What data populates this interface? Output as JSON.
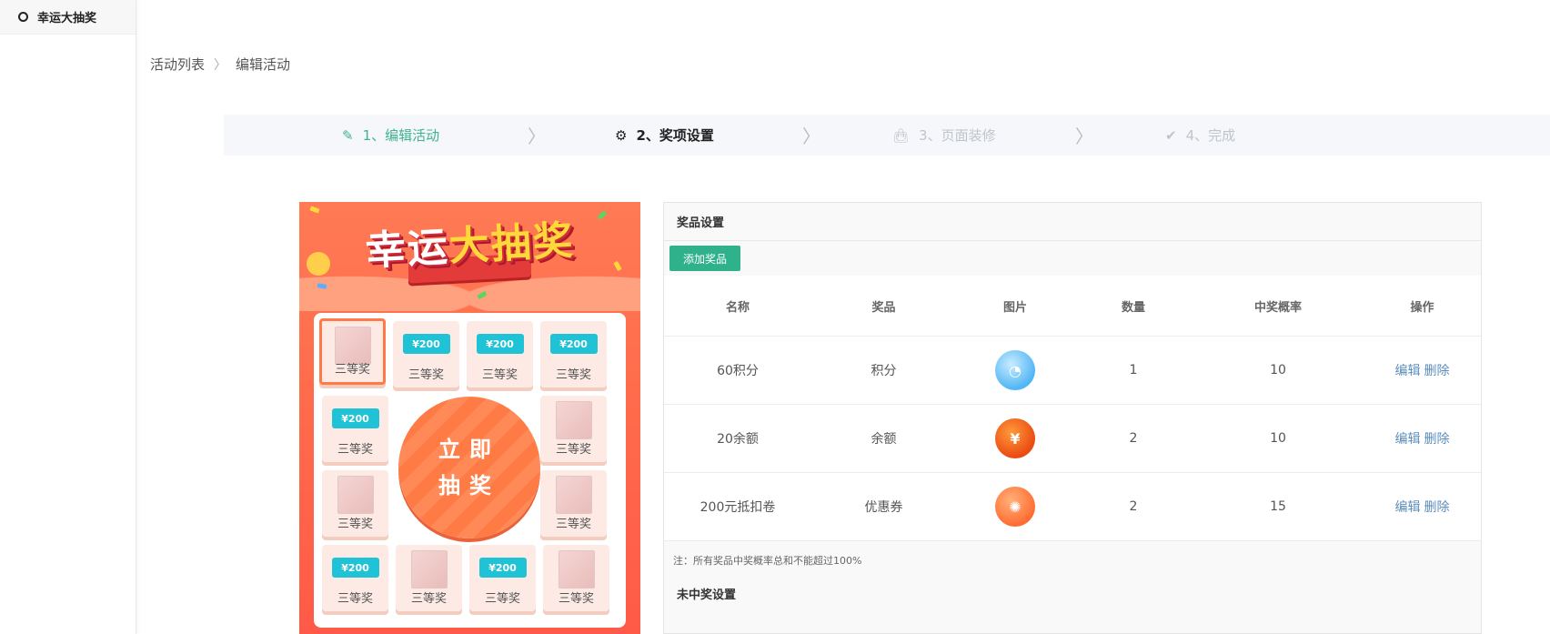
{
  "sidebar": {
    "items": [
      {
        "label": "幸运大抽奖"
      }
    ]
  },
  "breadcrumb": {
    "parent": "活动列表",
    "current": "编辑活动"
  },
  "steps": [
    {
      "label": "1、编辑活动",
      "state": "done",
      "icon": "edit-pen-icon"
    },
    {
      "label": "2、奖项设置",
      "state": "active",
      "icon": "gear-icon"
    },
    {
      "label": "3、页面装修",
      "state": "todo",
      "icon": "bag-icon"
    },
    {
      "label": "4、完成",
      "state": "todo",
      "icon": "check-circle-icon"
    }
  ],
  "preview": {
    "title_part1": "幸运",
    "title_part2": "大抽奖",
    "draw_button": "立即抽奖",
    "cells": [
      {
        "label": "三等奖",
        "type": "phone",
        "selected": true
      },
      {
        "label": "三等奖",
        "type": "coupon",
        "coupon_text": "¥200"
      },
      {
        "label": "三等奖",
        "type": "coupon",
        "coupon_text": "¥200"
      },
      {
        "label": "三等奖",
        "type": "coupon",
        "coupon_text": "¥200"
      },
      {
        "label": "三等奖",
        "type": "coupon",
        "coupon_text": "¥200"
      },
      {
        "label": "三等奖",
        "type": "phone"
      },
      {
        "label": "三等奖",
        "type": "phone"
      },
      {
        "label": "三等奖",
        "type": "phone"
      },
      {
        "label": "三等奖",
        "type": "coupon",
        "coupon_text": "¥200"
      },
      {
        "label": "三等奖",
        "type": "phone"
      },
      {
        "label": "三等奖",
        "type": "coupon",
        "coupon_text": "¥200"
      },
      {
        "label": "三等奖",
        "type": "phone"
      }
    ]
  },
  "panel": {
    "title": "奖品设置",
    "add_button": "添加奖品",
    "columns": [
      "名称",
      "奖品",
      "图片",
      "数量",
      "中奖概率",
      "操作"
    ],
    "rows": [
      {
        "name": "60积分",
        "prize": "积分",
        "icon": "pie-chart-icon",
        "qty": "1",
        "prob": "10"
      },
      {
        "name": "20余额",
        "prize": "余额",
        "icon": "yuan-coin-icon",
        "qty": "2",
        "prob": "10"
      },
      {
        "name": "200元抵扣卷",
        "prize": "优惠券",
        "icon": "wheel-icon",
        "qty": "2",
        "prob": "15"
      }
    ],
    "edit_label": "编辑",
    "delete_label": "删除",
    "note": "注：所有奖品中奖概率总和不能超过100%",
    "no_prize_title": "未中奖设置"
  },
  "colors": {
    "accent": "#2fb28c",
    "link": "#5a8dbd",
    "preview_bg": "#ff6a4b"
  }
}
